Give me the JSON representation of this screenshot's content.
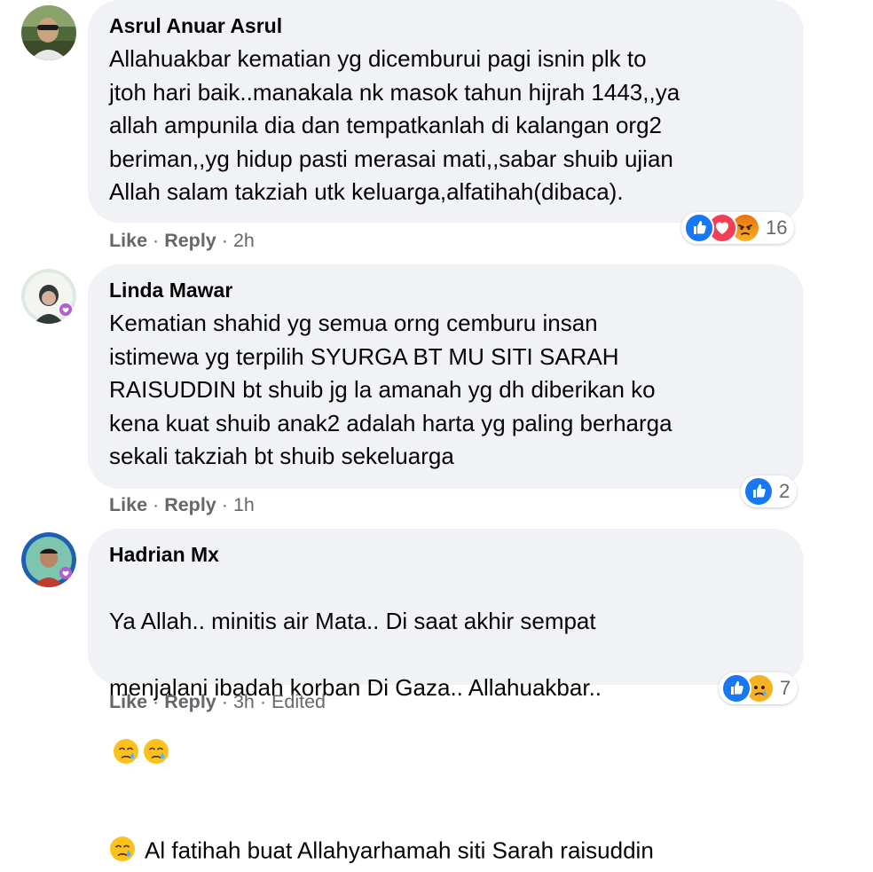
{
  "comments": [
    {
      "author": "Asrul Anuar Asrul",
      "text": "Allahuakbar kematian yg dicemburui pagi isnin plk to\njtoh hari baik..manakala nk masok tahun hijrah 1443,,ya\nallah ampunila dia dan tempatkanlah di kalangan org2\nberiman,,yg hidup pasti merasai mati,,sabar shuib ujian\nAllah salam takziah utk keluarga,alfatihah(dibaca).",
      "reactions": [
        "like-icon",
        "love-icon",
        "angry-icon"
      ],
      "reaction_count": "16",
      "like_label": "Like",
      "reply_label": "Reply",
      "separator": "·",
      "time": "2h"
    },
    {
      "author": "Linda Mawar",
      "text": "Kematian shahid yg semua orng cemburu insan\nistimewa yg terpilih SYURGA BT MU SITI SARAH\nRAISUDDIN bt shuib jg la amanah yg dh diberikan ko\nkena kuat shuib anak2 adalah harta yg paling berharga\nsekali takziah bt shuib sekeluarga",
      "reactions": [
        "like-icon"
      ],
      "reaction_count": "2",
      "like_label": "Like",
      "reply_label": "Reply",
      "separator": "·",
      "time": "1h"
    },
    {
      "author": "Hadrian Mx",
      "text_line1": "Ya Allah.. minitis air Mata.. Di saat akhir sempat",
      "text_line2": "menjalani ibadah korban Di Gaza.. Allahuakbar..",
      "text_line3": "Al fatihah buat Allahyarhamah siti Sarah raisuddin",
      "reactions": [
        "like-icon",
        "sad-icon"
      ],
      "reaction_count": "7",
      "like_label": "Like",
      "reply_label": "Reply",
      "separator": "·",
      "time": "3h",
      "edited_label": "Edited"
    }
  ],
  "colors": {
    "bubble": "#f0f2f5",
    "meta_text": "#65676b",
    "like_blue": "#1877f2",
    "love_red": "#f33e58",
    "angry_orange": "#e9710f",
    "emoji_yellow": "#fcc21b"
  }
}
